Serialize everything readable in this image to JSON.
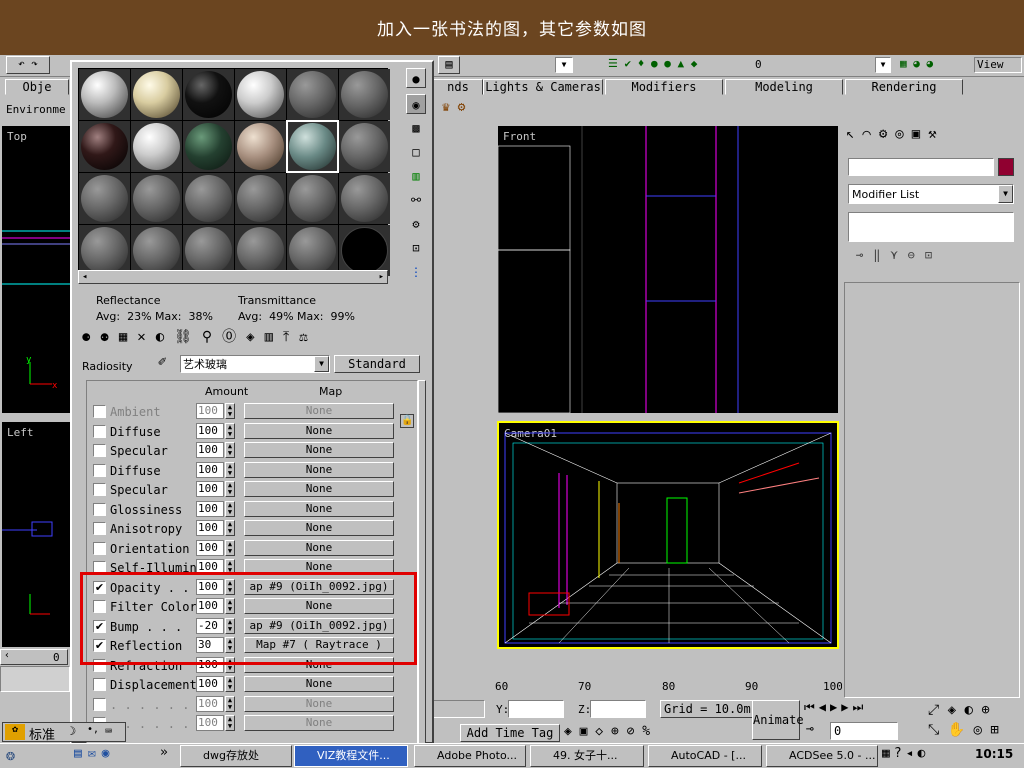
{
  "banner": {
    "title": "加入一张书法的图，其它参数如图"
  },
  "toolbar": {
    "selection_value": "0",
    "view_label": "View"
  },
  "tabs": [
    {
      "label": "Obje"
    },
    {
      "label": "nds"
    },
    {
      "label": "Lights & Cameras"
    },
    {
      "label": "Modifiers"
    },
    {
      "label": "Modeling"
    },
    {
      "label": "Rendering"
    }
  ],
  "env_label": "Environme",
  "viewports": {
    "top": "Top",
    "front": "Front",
    "left": "Left",
    "camera": "Camera01"
  },
  "material_editor": {
    "reflectance_label": "Reflectance",
    "reflectance_values": "Avg:  23% Max:  38%",
    "transmittance_label": "Transmittance",
    "transmittance_values": "Avg:  49% Max:  99%",
    "radiosity_label": "Radiosity",
    "material_name": "艺术玻璃",
    "material_type": "Standard",
    "col_amount": "Amount",
    "col_map": "Map",
    "maps": [
      {
        "label": "Ambient",
        "checked": false,
        "amount": "100",
        "map": "None",
        "disabled": true
      },
      {
        "label": "Diffuse",
        "checked": false,
        "amount": "100",
        "map": "None",
        "disabled": false
      },
      {
        "label": "Specular",
        "checked": false,
        "amount": "100",
        "map": "None",
        "disabled": false
      },
      {
        "label": "Diffuse",
        "checked": false,
        "amount": "100",
        "map": "None",
        "disabled": false
      },
      {
        "label": "Specular",
        "checked": false,
        "amount": "100",
        "map": "None",
        "disabled": false
      },
      {
        "label": "Glossiness",
        "checked": false,
        "amount": "100",
        "map": "None",
        "disabled": false
      },
      {
        "label": "Anisotropy",
        "checked": false,
        "amount": "100",
        "map": "None",
        "disabled": false
      },
      {
        "label": "Orientation",
        "checked": false,
        "amount": "100",
        "map": "None",
        "disabled": false
      },
      {
        "label": "Self-Illumin",
        "checked": false,
        "amount": "100",
        "map": "None",
        "disabled": false
      },
      {
        "label": "Opacity . .",
        "checked": true,
        "amount": "100",
        "map": "ap #9 (OiIh_0092.jpg)",
        "disabled": false
      },
      {
        "label": "Filter Color",
        "checked": false,
        "amount": "100",
        "map": "None",
        "disabled": false
      },
      {
        "label": "Bump  . . .",
        "checked": true,
        "amount": "-20",
        "map": "ap #9 (OiIh_0092.jpg)",
        "disabled": false
      },
      {
        "label": "Reflection",
        "checked": true,
        "amount": "30",
        "map": "Map #7  ( Raytrace )",
        "disabled": false
      },
      {
        "label": "Refraction",
        "checked": false,
        "amount": "100",
        "map": "None",
        "disabled": false
      },
      {
        "label": "Displacement",
        "checked": false,
        "amount": "100",
        "map": "None",
        "disabled": false
      },
      {
        "label": ". . . . . .",
        "checked": false,
        "amount": "100",
        "map": "None",
        "disabled": true
      },
      {
        "label": ". . . . . .",
        "checked": false,
        "amount": "100",
        "map": "None",
        "disabled": true
      }
    ]
  },
  "right_panel": {
    "modifier_list": "Modifier List"
  },
  "status": {
    "ruler_ticks": [
      "60",
      "70",
      "80",
      "90",
      "100"
    ],
    "y_label": "Y:",
    "z_label": "Z:",
    "grid": "Grid = 10.0m",
    "add_time_tag": "Add Time Tag",
    "animate": "Animate",
    "frame": "0",
    "scroll_value": "0"
  },
  "ime": {
    "mode": "标准"
  },
  "taskbar": {
    "items": [
      {
        "label": "dwg存放处"
      },
      {
        "label": "VIZ教程文件..."
      },
      {
        "label": "Adobe Photo..."
      },
      {
        "label": "49. 女子十..."
      },
      {
        "label": "AutoCAD - [..."
      },
      {
        "label": "ACDSee 5.0 - ..."
      }
    ],
    "clock": "10:15"
  },
  "colors": {
    "highlight_box": "#e00000",
    "banner_bg": "#6b4520",
    "camera_border": "#ffff00"
  }
}
